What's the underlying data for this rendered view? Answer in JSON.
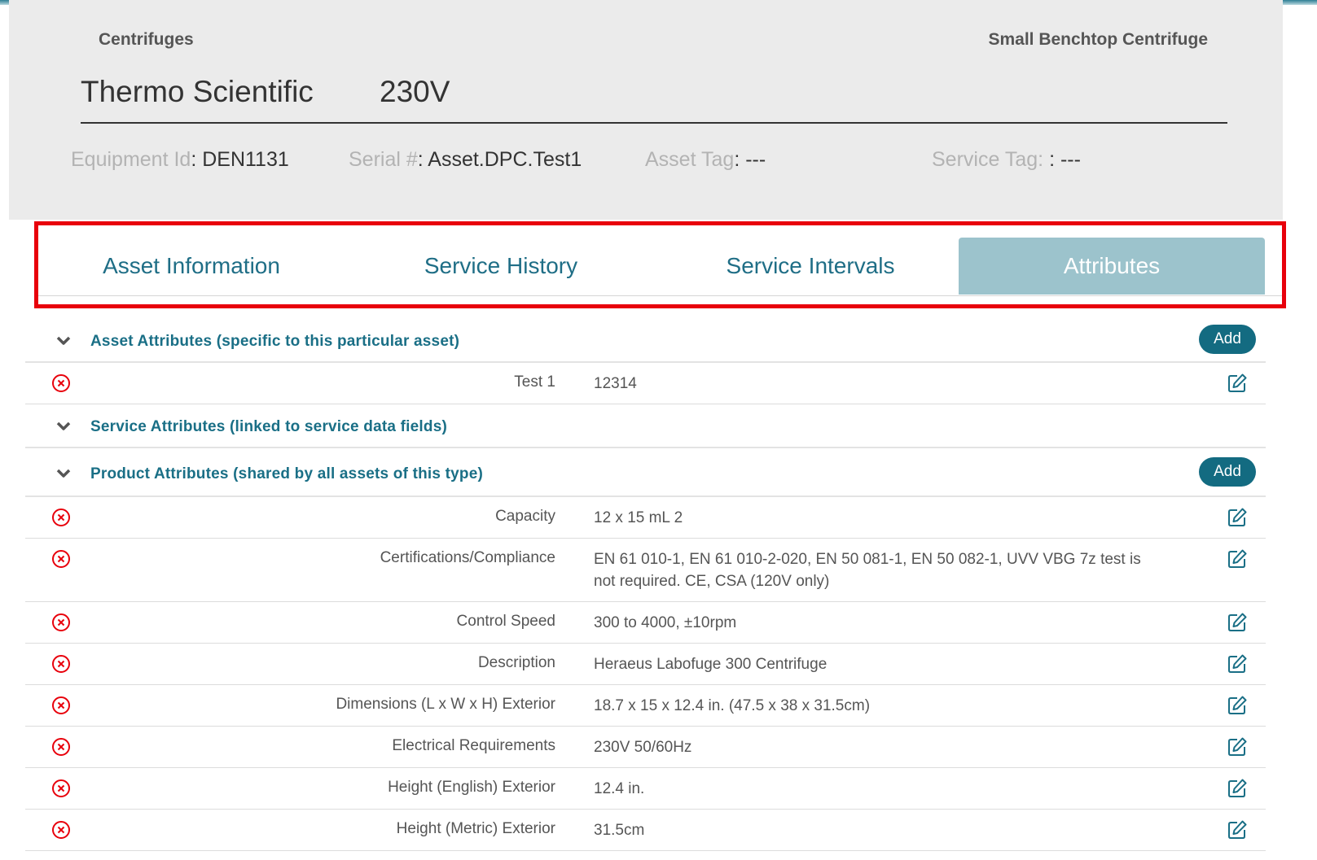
{
  "header": {
    "category": "Centrifuges",
    "model": "Small Benchtop Centrifuge",
    "manufacturer": "Thermo Scientific",
    "voltage": "230V",
    "equipment_id_label": "Equipment Id",
    "equipment_id_value": ": DEN1131",
    "serial_label": "Serial #",
    "serial_value": ": Asset.DPC.Test1",
    "asset_tag_label": "Asset Tag",
    "asset_tag_value": ": ---",
    "service_tag_label": "Service Tag: ",
    "service_tag_value": ": ---"
  },
  "tabs": [
    {
      "label": "Asset Information",
      "active": false
    },
    {
      "label": "Service History",
      "active": false
    },
    {
      "label": "Service Intervals",
      "active": false
    },
    {
      "label": "Attributes",
      "active": true
    }
  ],
  "sections": {
    "asset": {
      "title": "Asset Attributes (specific to this particular asset)",
      "add_label": "Add",
      "rows": [
        {
          "key": "Test 1",
          "value": "12314"
        }
      ]
    },
    "service": {
      "title": "Service Attributes (linked to service data fields)"
    },
    "product": {
      "title": "Product Attributes (shared by all assets of this type)",
      "add_label": "Add",
      "rows": [
        {
          "key": "Capacity",
          "value": "12 x 15 mL 2"
        },
        {
          "key": "Certifications/Compliance",
          "value": "EN 61 010-1, EN 61 010-2-020, EN 50 081-1, EN 50 082-1, UVV VBG 7z test is not required. CE, CSA (120V only)"
        },
        {
          "key": "Control Speed",
          "value": "300 to 4000, ±10rpm"
        },
        {
          "key": "Description",
          "value": "Heraeus Labofuge 300 Centrifuge"
        },
        {
          "key": "Dimensions (L x W x H) Exterior",
          "value": "18.7 x 15 x 12.4 in. (47.5 x 38 x 31.5cm)"
        },
        {
          "key": "Electrical Requirements",
          "value": "230V 50/60Hz"
        },
        {
          "key": "Height (English) Exterior",
          "value": "12.4 in."
        },
        {
          "key": "Height (Metric) Exterior",
          "value": "31.5cm"
        }
      ]
    }
  },
  "colors": {
    "accent": "#1a6f86",
    "active_tab": "#9cc3cc",
    "add_button": "#136b81",
    "delete_icon": "#e8000b",
    "highlight_box": "#e8000b"
  },
  "icons": {
    "delete": "circle-x-icon",
    "edit": "edit-icon",
    "collapse": "chevron-down-icon"
  }
}
